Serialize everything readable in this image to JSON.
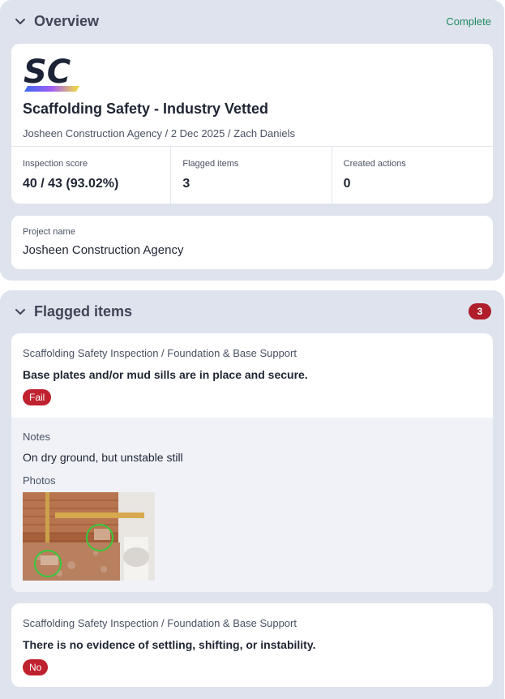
{
  "overview": {
    "title": "Overview",
    "status": "Complete",
    "status_color": "#1f8a60",
    "logo_text": "SC",
    "report_title": "Scaffolding Safety - Industry Vetted",
    "meta": "Josheen Construction Agency / 2 Dec 2025 / Zach Daniels",
    "stats": [
      {
        "label": "Inspection score",
        "value": "40 / 43 (93.02%)"
      },
      {
        "label": "Flagged items",
        "value": "3"
      },
      {
        "label": "Created actions",
        "value": "0"
      }
    ],
    "project": {
      "label": "Project name",
      "value": "Josheen Construction Agency"
    }
  },
  "flagged": {
    "title": "Flagged items",
    "count": "3",
    "items": [
      {
        "breadcrumb": "Scaffolding Safety Inspection / Foundation & Base Support",
        "question": "Base plates and/or mud sills are in place and secure.",
        "response": "Fail",
        "notes_label": "Notes",
        "notes": "On dry ground, but unstable still",
        "photos_label": "Photos"
      },
      {
        "breadcrumb": "Scaffolding Safety Inspection / Foundation & Base Support",
        "question": "There is no evidence of settling, shifting, or instability.",
        "response": "No"
      }
    ]
  },
  "colors": {
    "accent_red": "#c0212f",
    "section_bg": "#dfe3ee"
  }
}
